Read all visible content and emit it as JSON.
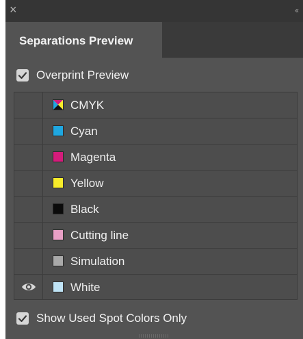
{
  "panel": {
    "close_glyph": "×",
    "collapse_glyph": "‹‹",
    "tab_title": "Separations Preview"
  },
  "overprint": {
    "label": "Overprint Preview",
    "checked": true
  },
  "separations": [
    {
      "label": "CMYK",
      "color": "cmyk",
      "eye_visible": false
    },
    {
      "label": "Cyan",
      "color": "#1fa7e0",
      "eye_visible": false
    },
    {
      "label": "Magenta",
      "color": "#d31c7b",
      "eye_visible": false
    },
    {
      "label": "Yellow",
      "color": "#f7ec2a",
      "eye_visible": false
    },
    {
      "label": "Black",
      "color": "#0b0b0b",
      "eye_visible": false
    },
    {
      "label": "Cutting line",
      "color": "#e8a0c6",
      "eye_visible": false
    },
    {
      "label": "Simulation",
      "color": "#a9a9a9",
      "eye_visible": false
    },
    {
      "label": "White",
      "color": "#bfe3f5",
      "eye_visible": true
    }
  ],
  "spot_colors_only": {
    "label": "Show Used Spot Colors Only",
    "checked": true
  },
  "icons": {
    "eye": "eye-icon",
    "close": "close-icon",
    "collapse": "collapse-icon"
  }
}
